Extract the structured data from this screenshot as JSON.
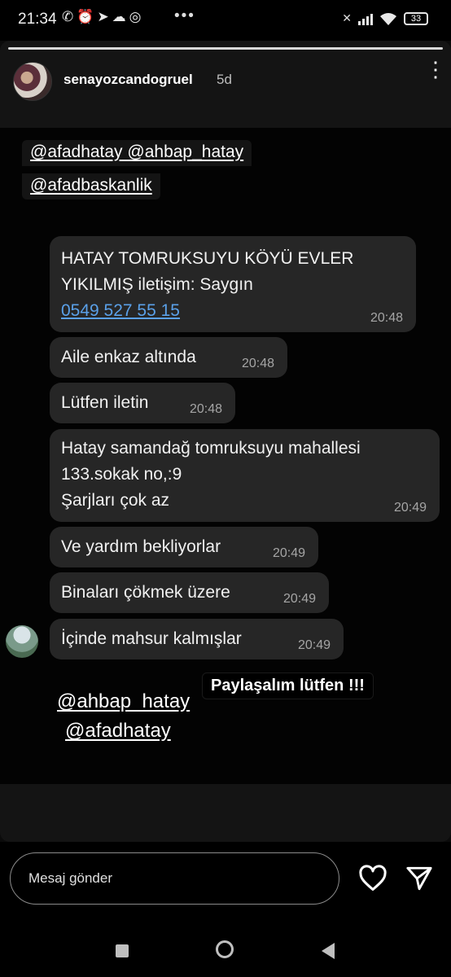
{
  "status_bar": {
    "time": "21:34",
    "left_icons": "✆⏰➤☁◎",
    "dots": "•••",
    "battery": "33"
  },
  "story": {
    "username": "senayozcandogruel",
    "time_ago": "5d",
    "more_icon": "⋮",
    "tags": [
      "@afadhatay @ahbap_hatay",
      "@afadbaskanlik"
    ],
    "messages": [
      {
        "lines": [
          "HATAY TOMRUKSUYU KÖYÜ EVLER",
          "YIKILMIŞ iletişim: Saygın"
        ],
        "phone": "0549 527 55 15",
        "time": "20:48"
      },
      {
        "lines": [
          "Aile enkaz altında"
        ],
        "time": "20:48"
      },
      {
        "lines": [
          "Lütfen iletin"
        ],
        "time": "20:48"
      },
      {
        "lines": [
          "Hatay samandağ tomruksuyu mahallesi",
          "133.sokak no,:9",
          "Şarjları çok az"
        ],
        "time": "20:49"
      },
      {
        "lines": [
          "Ve yardım bekliyorlar"
        ],
        "time": "20:49"
      },
      {
        "lines": [
          "Binaları çökmek üzere"
        ],
        "time": "20:49"
      },
      {
        "lines": [
          "İçinde mahsur kalmışlar"
        ],
        "time": "20:49"
      }
    ],
    "share_label": "Paylaşalım lütfen !!!",
    "mentions": [
      "@ahbap_hatay",
      "@afadhatay"
    ]
  },
  "reply": {
    "placeholder": "Mesaj gönder"
  },
  "icons": {
    "heart": "heart-icon",
    "send": "send-icon"
  },
  "colors": {
    "bubble": "#262626",
    "link": "#5aa0e8",
    "background": "#0b0b0b"
  }
}
